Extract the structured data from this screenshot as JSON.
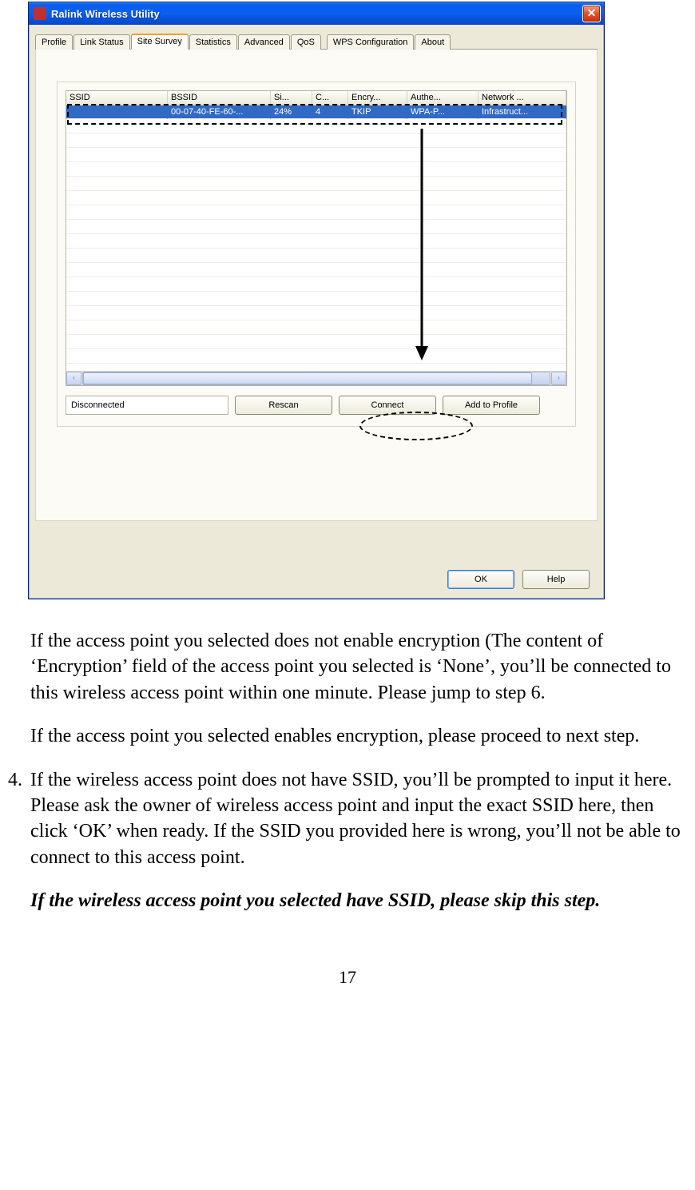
{
  "window": {
    "title": "Ralink Wireless Utility",
    "close_label": "X",
    "tabs": [
      "Profile",
      "Link Status",
      "Site Survey",
      "Statistics",
      "Advanced",
      "QoS",
      "WPS Configuration",
      "About"
    ],
    "active_tab": "Site Survey",
    "grid": {
      "headers": [
        "SSID",
        "BSSID",
        "Si...",
        "C...",
        "Encry...",
        "Authe...",
        "Network ..."
      ],
      "rows": [
        {
          "ssid": "",
          "bssid": "00-07-40-FE-60-...",
          "signal": "24%",
          "channel": "4",
          "encryption": "TKIP",
          "auth": "WPA-P...",
          "network": "Infrastruct..."
        }
      ]
    },
    "status": "Disconnected",
    "buttons": {
      "rescan": "Rescan",
      "connect": "Connect",
      "addprofile": "Add to Profile"
    },
    "bottom": {
      "ok": "OK",
      "help": "Help"
    },
    "scroll": {
      "left": "‹",
      "right": "›"
    }
  },
  "doc": {
    "p1": "If the access point you selected does not enable encryption (The content of ‘Encryption’ field of the access point you selected is ‘None’, you’ll be connected to this wireless access point within one minute. Please jump to step 6.",
    "p2": "If the access point you selected enables encryption, please proceed to next step.",
    "item4_num": "4.",
    "item4": "If the wireless access point does not have SSID, you’ll be prompted to input it here. Please ask the owner of wireless access point and input the exact SSID here, then click ‘OK’ when ready. If the SSID you provided here is wrong, you’ll not be able to connect to this access point.",
    "p3": "If the wireless access point you selected have SSID, please skip this step.",
    "page": "17"
  }
}
